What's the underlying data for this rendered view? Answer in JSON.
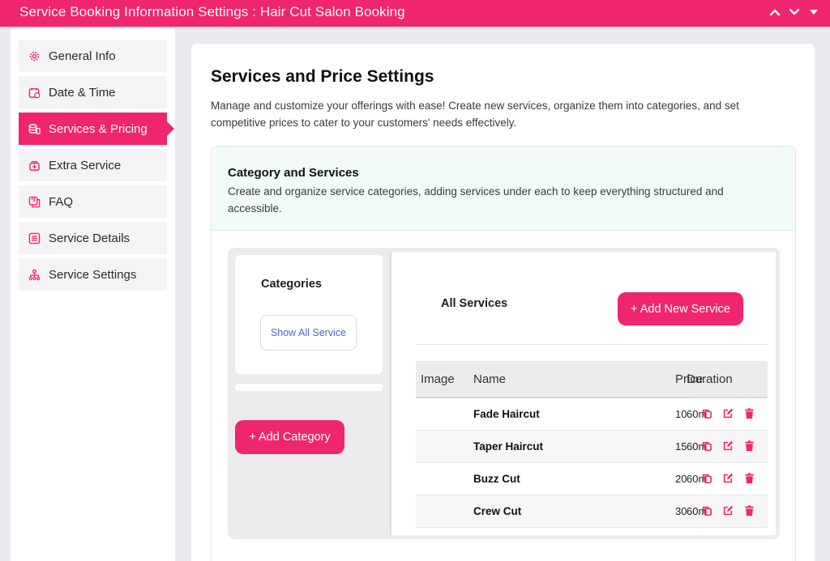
{
  "header": {
    "title": "Service Booking Information Settings : Hair Cut Salon Booking"
  },
  "sidebar": {
    "items": [
      {
        "label": "General Info",
        "icon": "gear-icon"
      },
      {
        "label": "Date & Time",
        "icon": "calendar-icon"
      },
      {
        "label": "Services & Pricing",
        "icon": "coins-icon",
        "active": true
      },
      {
        "label": "Extra Service",
        "icon": "gift-icon"
      },
      {
        "label": "FAQ",
        "icon": "faq-icon"
      },
      {
        "label": "Service Details",
        "icon": "list-icon"
      },
      {
        "label": "Service Settings",
        "icon": "sitemap-icon"
      }
    ]
  },
  "main": {
    "title": "Services and Price Settings",
    "description": "Manage and customize your offerings with ease! Create new services, organize them into categories, and set competitive prices to cater to your customers' needs effectively."
  },
  "category_panel": {
    "title": "Category and Services",
    "description": "Create and organize service categories, adding services under each to keep everything structured and accessible.",
    "categories_title": "Categories",
    "show_all_label": "Show All Service",
    "add_category_label": "+ Add Category"
  },
  "services": {
    "title": "All Services",
    "add_label": "+ Add New Service",
    "columns": {
      "image": "Image",
      "name": "Name",
      "price": "Price",
      "duration": "Duration"
    },
    "rows": [
      {
        "name": "Fade Haircut",
        "price": "10",
        "duration": "60m"
      },
      {
        "name": "Taper Haircut",
        "price": "15",
        "duration": "60m"
      },
      {
        "name": "Buzz Cut",
        "price": "20",
        "duration": "60m"
      },
      {
        "name": "Crew Cut",
        "price": "30",
        "duration": "60m"
      }
    ]
  },
  "colors": {
    "accent": "#f0256f",
    "link": "#4a68c8",
    "panel_tint": "#f2fbfa"
  }
}
